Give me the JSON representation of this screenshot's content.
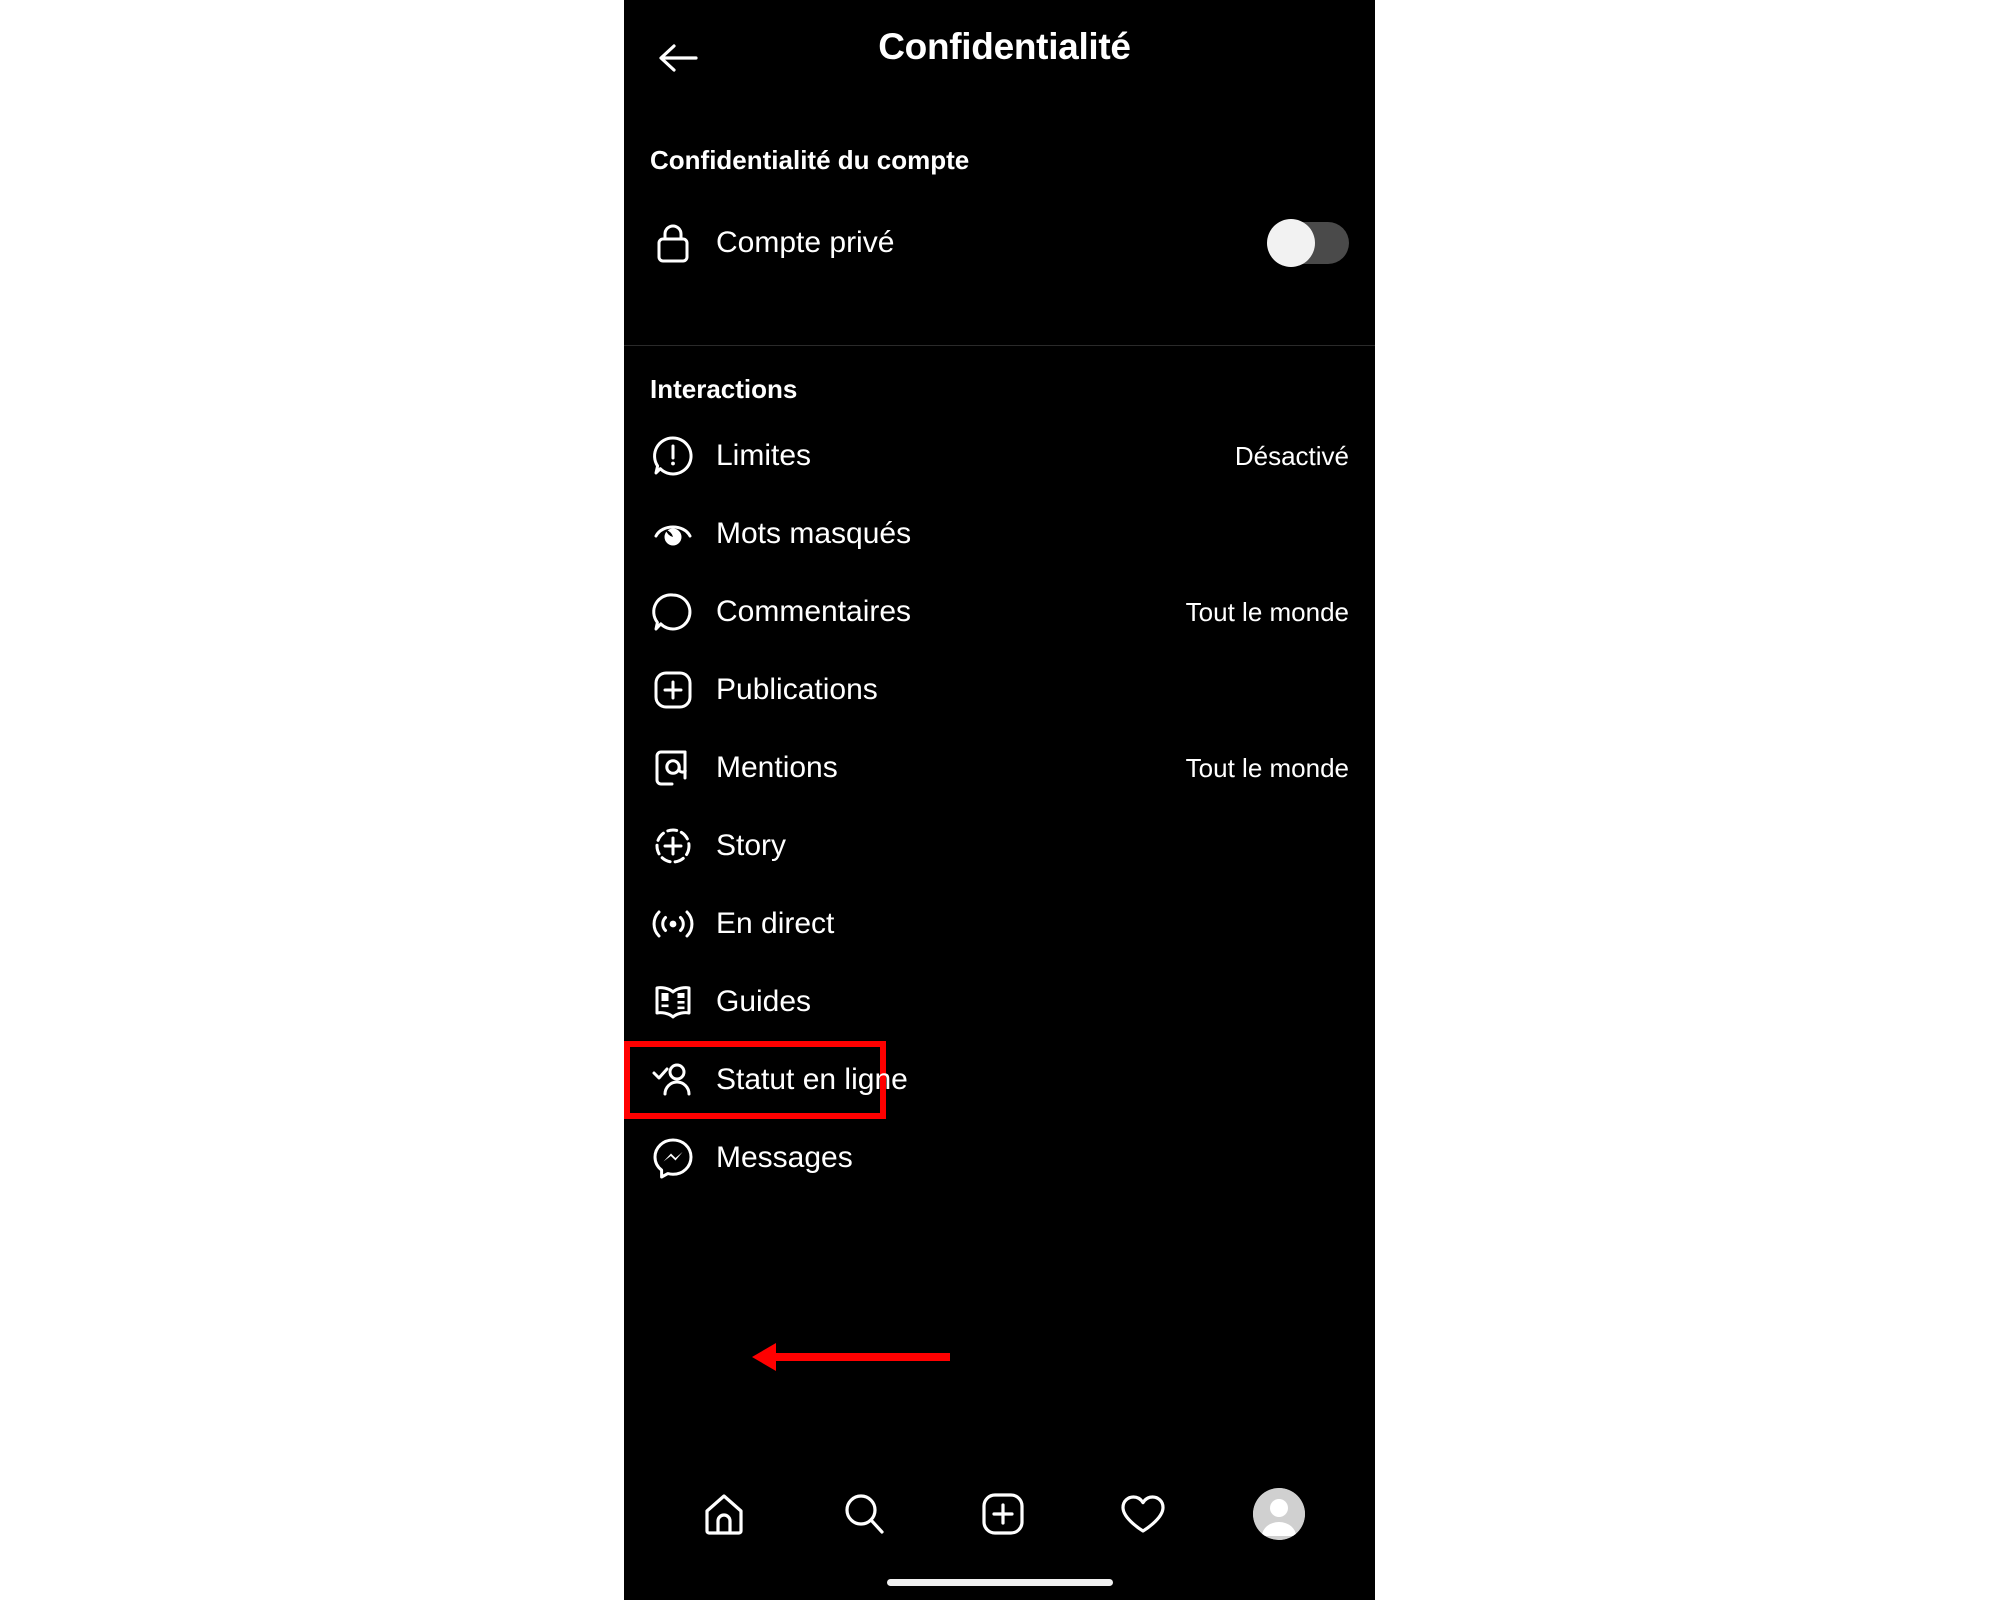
{
  "header": {
    "title": "Confidentialité",
    "back_icon": "arrow-left-icon"
  },
  "account_section": {
    "title": "Confidentialité du compte",
    "private_account": {
      "label": "Compte privé",
      "icon": "lock-icon",
      "toggle_state": "off"
    }
  },
  "interactions_section": {
    "title": "Interactions",
    "items": [
      {
        "label": "Limites",
        "value": "Désactivé",
        "icon": "exclamation-bubble-icon"
      },
      {
        "label": "Mots masqués",
        "value": "",
        "icon": "eye-icon"
      },
      {
        "label": "Commentaires",
        "value": "Tout le monde",
        "icon": "comment-bubble-icon"
      },
      {
        "label": "Publications",
        "value": "",
        "icon": "plus-square-icon"
      },
      {
        "label": "Mentions",
        "value": "Tout le monde",
        "icon": "at-sign-icon"
      },
      {
        "label": "Story",
        "value": "",
        "icon": "story-plus-icon"
      },
      {
        "label": "En direct",
        "value": "",
        "icon": "live-broadcast-icon"
      },
      {
        "label": "Guides",
        "value": "",
        "icon": "guides-book-icon"
      },
      {
        "label": "Statut en ligne",
        "value": "",
        "icon": "person-check-icon"
      },
      {
        "label": "Messages",
        "value": "",
        "icon": "messenger-icon"
      }
    ]
  },
  "annotation": {
    "highlight_color": "#ff0000",
    "highlighted_item": "Statut en ligne",
    "arrow_direction": "left"
  },
  "bottom_nav": {
    "items": [
      {
        "icon": "home-icon"
      },
      {
        "icon": "search-icon"
      },
      {
        "icon": "plus-square-icon"
      },
      {
        "icon": "heart-icon"
      },
      {
        "icon": "avatar-icon"
      }
    ]
  }
}
